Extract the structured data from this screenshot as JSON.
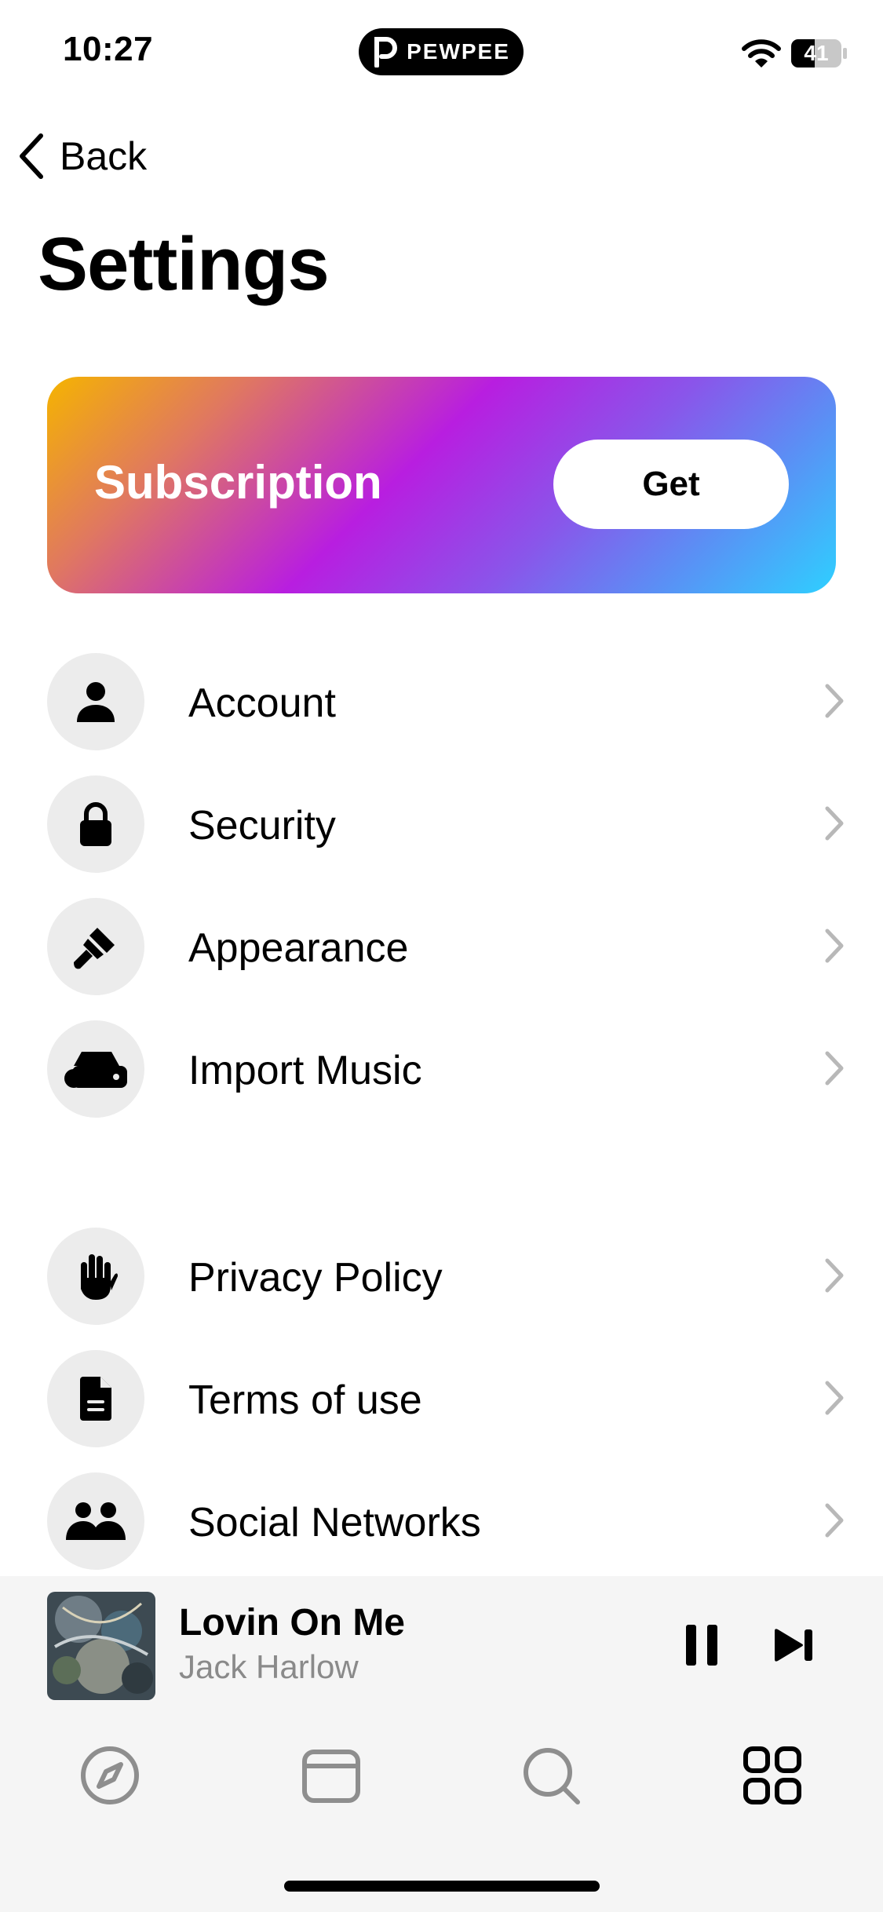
{
  "status_bar": {
    "time": "10:27",
    "app_pill": "PEWPEE",
    "battery": "41"
  },
  "nav": {
    "back_label": "Back",
    "title": "Settings"
  },
  "subscription": {
    "label": "Subscription",
    "button": "Get"
  },
  "menu_group_1": [
    {
      "label": "Account",
      "icon": "person-icon"
    },
    {
      "label": "Security",
      "icon": "lock-icon"
    },
    {
      "label": "Appearance",
      "icon": "paintbrush-icon"
    },
    {
      "label": "Import Music",
      "icon": "cloud-drive-icon"
    }
  ],
  "menu_group_2": [
    {
      "label": "Privacy Policy",
      "icon": "hand-icon"
    },
    {
      "label": "Terms of use",
      "icon": "document-icon"
    },
    {
      "label": "Social Networks",
      "icon": "people-icon"
    }
  ],
  "now_playing": {
    "title": "Lovin On Me",
    "artist": "Jack Harlow"
  },
  "tabs": [
    "compass-icon",
    "cards-icon",
    "search-icon",
    "grid-icon"
  ],
  "colors": {
    "gradient": [
      "#f5b400",
      "#b81ee0",
      "#2ed0ff"
    ],
    "icon_bg": "#ececec",
    "chevron": "#b8b8b8"
  }
}
